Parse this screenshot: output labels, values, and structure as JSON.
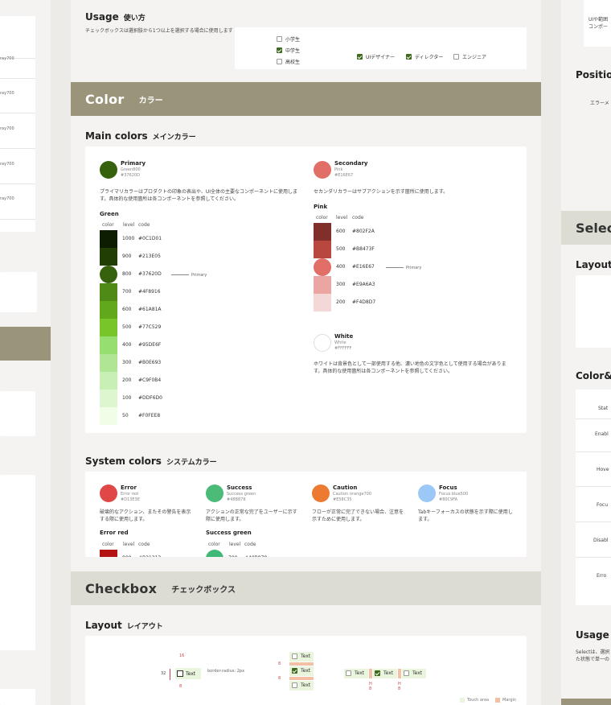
{
  "left_col": {
    "items": [
      "ray700",
      "ray700",
      "ray700",
      "ray700",
      "ray700",
      "ray700"
    ]
  },
  "usage": {
    "title": "Usage",
    "title_jp": "使い方",
    "desc": "チェックボックスは選択肢から1つ以上を選択する場合に使用します",
    "list": [
      {
        "label": "小学生",
        "checked": false
      },
      {
        "label": "中学生",
        "checked": true
      },
      {
        "label": "高校生",
        "checked": false
      }
    ],
    "row": [
      {
        "label": "UIデザイナー",
        "checked": true
      },
      {
        "label": "ディレクター",
        "checked": true
      },
      {
        "label": "エンジニア",
        "checked": false
      }
    ]
  },
  "color_band": {
    "en": "Color",
    "jp": "カラー"
  },
  "main_colors": {
    "title": "Main colors",
    "title_jp": "メインカラー"
  },
  "primary": {
    "name": "Primary",
    "sub": "Green800",
    "hex": "#37620D",
    "color": "#37620d",
    "desc": "プライマリカラーはプロダクトの印象の表出や、UI全体の主要なコンポーネントに使用します。具体的な使用箇所は各コンポーネントを参照してください。"
  },
  "green": {
    "title": "Green",
    "headers": [
      "color",
      "level",
      "code"
    ],
    "primary_note": "Primary",
    "rows": [
      {
        "level": "1000",
        "code": "#0C1D01",
        "color": "#0c1d01"
      },
      {
        "level": "900",
        "code": "#213E05",
        "color": "#213e05"
      },
      {
        "level": "800",
        "code": "#37620D",
        "color": "#37620d"
      },
      {
        "level": "700",
        "code": "#4F8916",
        "color": "#4f8916"
      },
      {
        "level": "600",
        "code": "#61A81A",
        "color": "#61a81a"
      },
      {
        "level": "500",
        "code": "#77C529",
        "color": "#77c529"
      },
      {
        "level": "400",
        "code": "#95DE6F",
        "color": "#95de6f"
      },
      {
        "level": "300",
        "code": "#B0E693",
        "color": "#b0e693"
      },
      {
        "level": "200",
        "code": "#C9F0B4",
        "color": "#c9f0b4"
      },
      {
        "level": "100",
        "code": "#DDF6D0",
        "color": "#ddf6d0"
      },
      {
        "level": "50",
        "code": "#F0FEE8",
        "color": "#f0fee8"
      }
    ]
  },
  "secondary": {
    "name": "Secondary",
    "sub": "Pink",
    "hex": "#E16E67",
    "color": "#e16e67",
    "desc": "セカンダリカラーはサブアクションを示す箇所に使用します。"
  },
  "pink": {
    "title": "Pink",
    "headers": [
      "color",
      "level",
      "code"
    ],
    "primary_note": "Primary",
    "rows": [
      {
        "level": "600",
        "code": "#802F2A",
        "color": "#802f2a"
      },
      {
        "level": "500",
        "code": "#B8473F",
        "color": "#b8473f"
      },
      {
        "level": "400",
        "code": "#E16E67",
        "color": "#e16e67"
      },
      {
        "level": "300",
        "code": "#E9A6A3",
        "color": "#e9a6a3"
      },
      {
        "level": "200",
        "code": "#F4D8D7",
        "color": "#f4d8d7"
      }
    ]
  },
  "white": {
    "name": "White",
    "sub": "White",
    "hex": "#FFFFFF",
    "desc": "ホワイトは背景色として一部使用する他、濃い地色の文字色として使用する場合があります。具体的な使用箇所は各コンポーネントを参照してください。"
  },
  "system_colors": {
    "title": "System colors",
    "title_jp": "システムカラー",
    "items": [
      {
        "name": "Error",
        "sub": "Error red",
        "hex": "#D13E3E",
        "color": "#e04848",
        "desc": "破壊的なアクション、またその警告を表示する際に使用します。"
      },
      {
        "name": "Success",
        "sub": "Success green",
        "hex": "#48B878",
        "color": "#4cbb78",
        "desc": "アクションの正常な完了をユーザーに示す際に使用します。"
      },
      {
        "name": "Caution",
        "sub": "Caution orange700",
        "hex": "#E58C35",
        "color": "#ec7a33",
        "desc": "フローが正常に完了できない場合、注意を示すために使用します。"
      },
      {
        "name": "Focus",
        "sub": "Focus blue500",
        "hex": "#80C9FA",
        "color": "#9cc8f8",
        "desc": "Tabキーフォーカスの状態を示す際に使用します。"
      }
    ],
    "error_red": {
      "title": "Error red",
      "headers": [
        "color",
        "level",
        "code"
      ],
      "level": "800",
      "code": "#B31313"
    },
    "success_green": {
      "title": "Success green",
      "headers": [
        "color",
        "level",
        "code"
      ],
      "level": "700",
      "code": "#40B878"
    }
  },
  "checkbox_band": {
    "en": "Checkbox",
    "jp": "チェックボックス"
  },
  "layout": {
    "title": "Layout",
    "title_jp": "レイアウト",
    "dim_16": "16",
    "dim_32": "32",
    "dim_8": "8",
    "radius": "border-radius: 2px",
    "text": "Text",
    "h": "H",
    "legend_touch": "Touch area",
    "legend_margin": "Margin"
  },
  "right_col": {
    "top_text": "UIや範囲コンポー",
    "position": "Position",
    "position_body": "エラーメ",
    "select": "Selec",
    "layout": "Layout",
    "colorstate": "Color&S",
    "states": [
      "Stat",
      "Enabl",
      "Hove",
      "Focu",
      "Disabl",
      "Erro"
    ],
    "usage": "Usage",
    "usage_body": "Selectは、選択た状態で単一の"
  }
}
